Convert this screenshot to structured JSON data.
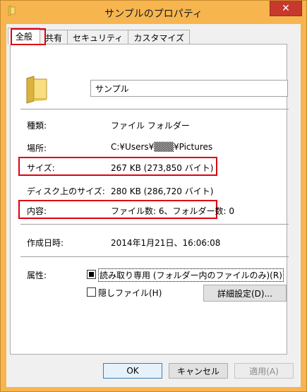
{
  "window": {
    "title": "サンプルのプロパティ",
    "close_glyph": "✕"
  },
  "tabs": [
    {
      "label": "全般",
      "active": true
    },
    {
      "label": "共有",
      "active": false
    },
    {
      "label": "セキュリティ",
      "active": false
    },
    {
      "label": "カスタマイズ",
      "active": false
    }
  ],
  "general": {
    "folder_name": "サンプル",
    "fields": {
      "type_label": "種類:",
      "type_value": "ファイル フォルダー",
      "location_label": "場所:",
      "location_value": "C:¥Users¥▒▒▒¥Pictures",
      "size_label": "サイズ:",
      "size_value": "267 KB (273,850 バイト)",
      "disk_size_label": "ディスク上のサイズ:",
      "disk_size_value": "280 KB (286,720 バイト)",
      "contents_label": "内容:",
      "contents_value": "ファイル数: 6、フォルダー数: 0",
      "created_label": "作成日時:",
      "created_value": "2014年1月21日、16:06:08"
    },
    "attributes": {
      "label": "属性:",
      "readonly_label": "読み取り専用 (フォルダー内のファイルのみ)(R)",
      "readonly_state": "indeterminate",
      "hidden_label": "隠しファイル(H)",
      "hidden_state": "unchecked",
      "advanced_button": "詳細設定(D)..."
    }
  },
  "buttons": {
    "ok": "OK",
    "cancel": "キャンセル",
    "apply": "適用(A)"
  },
  "colors": {
    "title_bar": "#f6b54f",
    "close_button": "#c7392d",
    "highlight": "#e0000f"
  }
}
